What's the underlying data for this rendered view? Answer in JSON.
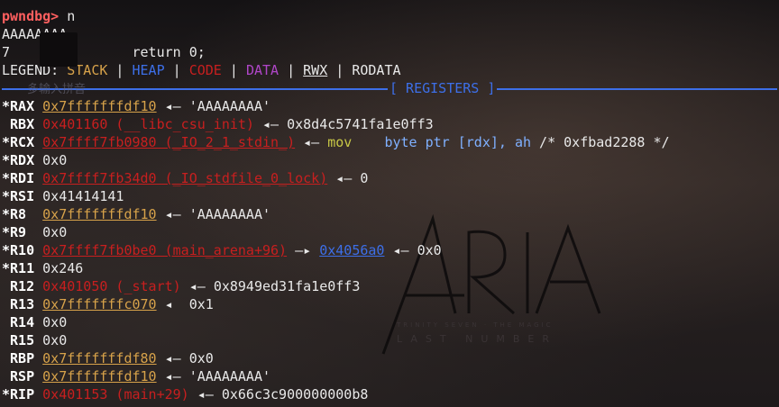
{
  "prompt": "pwndbg>",
  "command": "n",
  "output_line": "AAAAAAAA",
  "source_line": {
    "num": "7",
    "code": "return 0;"
  },
  "legend": {
    "label": "LEGEND:",
    "items": [
      "STACK",
      "HEAP",
      "CODE",
      "DATA",
      "RWX",
      "RODATA"
    ]
  },
  "ime_hint": "多输入拼音",
  "section_title": "[ REGISTERS ]",
  "registers": [
    {
      "mark": "*",
      "name": "RAX",
      "addr": "0x7fffffffdf10",
      "kind": "stack",
      "chain": [
        {
          "t": "arrow",
          "v": " ◂— "
        },
        {
          "t": "plain",
          "v": "'AAAAAAAA'"
        }
      ]
    },
    {
      "mark": " ",
      "name": "RBX",
      "addr": "0x401160 (__libc_csu_init)",
      "kind": "code",
      "chain": [
        {
          "t": "arrow",
          "v": " ◂— "
        },
        {
          "t": "plain",
          "v": "0x8d4c5741fa1e0ff3"
        }
      ]
    },
    {
      "mark": "*",
      "name": "RCX",
      "addr": "0x7ffff7fb0980 (_IO_2_1_stdin_)",
      "kind": "libc",
      "chain": [
        {
          "t": "arrow",
          "v": " ◂— "
        },
        {
          "t": "mn",
          "v": "mov"
        },
        {
          "t": "plain",
          "v": "    "
        },
        {
          "t": "op",
          "v": "byte ptr [rdx], ah"
        },
        {
          "t": "plain",
          "v": " /* 0xfbad2288 */"
        }
      ]
    },
    {
      "mark": "*",
      "name": "RDX",
      "addr": "",
      "kind": "plain",
      "value": "0x0",
      "chain": []
    },
    {
      "mark": "*",
      "name": "RDI",
      "addr": "0x7ffff7fb34d0 (_IO_stdfile_0_lock)",
      "kind": "libc",
      "chain": [
        {
          "t": "arrow",
          "v": " ◂— "
        },
        {
          "t": "plain",
          "v": "0"
        }
      ]
    },
    {
      "mark": "*",
      "name": "RSI",
      "addr": "",
      "kind": "plain",
      "value": "0x41414141",
      "chain": []
    },
    {
      "mark": "*",
      "name": "R8",
      "addr": "0x7fffffffdf10",
      "kind": "stack",
      "chain": [
        {
          "t": "arrow",
          "v": " ◂— "
        },
        {
          "t": "plain",
          "v": "'AAAAAAAA'"
        }
      ]
    },
    {
      "mark": "*",
      "name": "R9",
      "addr": "",
      "kind": "plain",
      "value": "0x0",
      "chain": []
    },
    {
      "mark": "*",
      "name": "R10",
      "addr": "0x7ffff7fb0be0 (main_arena+96)",
      "kind": "libc",
      "chain": [
        {
          "t": "arrow",
          "v": " —▸ "
        },
        {
          "t": "heap",
          "v": "0x4056a0"
        },
        {
          "t": "arrow",
          "v": " ◂— "
        },
        {
          "t": "plain",
          "v": "0x0"
        }
      ]
    },
    {
      "mark": "*",
      "name": "R11",
      "addr": "",
      "kind": "plain",
      "value": "0x246",
      "chain": []
    },
    {
      "mark": " ",
      "name": "R12",
      "addr": "0x401050 (_start)",
      "kind": "code",
      "chain": [
        {
          "t": "arrow",
          "v": " ◂— "
        },
        {
          "t": "plain",
          "v": "0x8949ed31fa1e0ff3"
        }
      ]
    },
    {
      "mark": " ",
      "name": "R13",
      "addr": "0x7fffffffc070",
      "kind": "stack",
      "chain": [
        {
          "t": "arrow",
          "v": " ◂  "
        },
        {
          "t": "plain",
          "v": "0x1"
        }
      ]
    },
    {
      "mark": " ",
      "name": "R14",
      "addr": "",
      "kind": "plain",
      "value": "0x0",
      "chain": []
    },
    {
      "mark": " ",
      "name": "R15",
      "addr": "",
      "kind": "plain",
      "value": "0x0",
      "chain": []
    },
    {
      "mark": " ",
      "name": "RBP",
      "addr": "0x7fffffffdf80",
      "kind": "stack",
      "chain": [
        {
          "t": "arrow",
          "v": " ◂— "
        },
        {
          "t": "plain",
          "v": "0x0"
        }
      ]
    },
    {
      "mark": " ",
      "name": "RSP",
      "addr": "0x7fffffffdf10",
      "kind": "stack",
      "chain": [
        {
          "t": "arrow",
          "v": " ◂— "
        },
        {
          "t": "plain",
          "v": "'AAAAAAAA'"
        }
      ]
    },
    {
      "mark": "*",
      "name": "RIP",
      "addr": "0x401153 (main+29)",
      "kind": "code",
      "chain": [
        {
          "t": "arrow",
          "v": " ◂— "
        },
        {
          "t": "plain",
          "v": "0x66c3c900000000b8"
        }
      ]
    }
  ],
  "watermark": {
    "big": "ARIA",
    "small_top": "TRINITY SEVEN · THE MAGIC",
    "small_bottom": "LAST NUMBER"
  },
  "colors": {
    "stack": "#d7a24a",
    "heap": "#3d6fe8",
    "code": "#c81f1f",
    "data": "#b046c8",
    "prompt": "#ff5f5f"
  }
}
